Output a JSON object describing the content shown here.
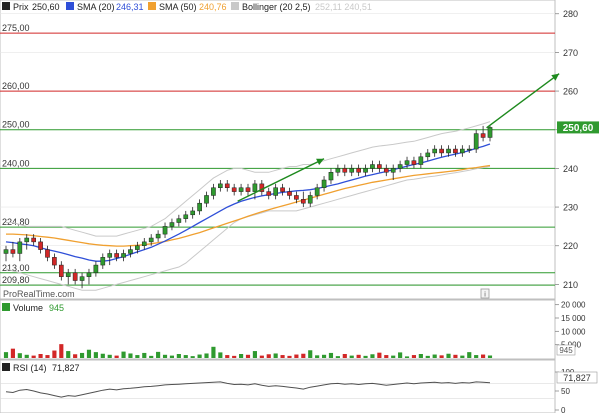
{
  "legend": {
    "price_label": "Prix",
    "price_value": "250,60",
    "sma20_label": "SMA (20)",
    "sma20_value": "246,31",
    "sma50_label": "SMA (50)",
    "sma50_value": "240,76",
    "boll_label": "Bollinger (20 2,5)",
    "boll_value": "252,11  240,51"
  },
  "watermark": "ProRealTime.com",
  "info_icon": "i",
  "price_axis": {
    "ticks": [
      "280",
      "270",
      "260",
      "250",
      "240",
      "230",
      "220",
      "210"
    ],
    "current_label": "250,60"
  },
  "levels": [
    {
      "label": "275,00",
      "value": 275,
      "color": "#d22727"
    },
    {
      "label": "260,00",
      "value": 260,
      "color": "#d22727"
    },
    {
      "label": "250,00",
      "value": 250,
      "color": "#2f9a2f"
    },
    {
      "label": "240,00",
      "value": 240,
      "color": "#2f9a2f"
    },
    {
      "label": "224,80",
      "value": 224.8,
      "color": "#2f9a2f"
    },
    {
      "label": "213,00",
      "value": 213,
      "color": "#2f9a2f"
    },
    {
      "label": "209,80",
      "value": 209.8,
      "color": "#2f9a2f"
    }
  ],
  "volume_panel": {
    "label": "Volume",
    "value": "945",
    "ticks": [
      "20 000",
      "15 000",
      "10 000",
      "5 000"
    ],
    "current_label": "945"
  },
  "rsi_panel": {
    "label": "RSI (14)",
    "value": "71,827",
    "ticks": [
      "100",
      "50",
      "0"
    ],
    "current_label": "71,827"
  },
  "colors": {
    "up": "#2f9a2f",
    "down": "#d22727",
    "sma20": "#2f4fd8",
    "sma50": "#f0a030",
    "bollinger": "#c9c9c9",
    "arrow": "#1e8a1e",
    "rsi": "#505050",
    "grid": "#e6e6e6"
  },
  "chart_data": {
    "type": "candlestick",
    "y_range": [
      207,
      282
    ],
    "candles": [
      [
        218,
        220,
        216,
        219
      ],
      [
        219,
        221,
        217,
        218
      ],
      [
        218,
        222,
        216,
        221
      ],
      [
        221,
        223,
        219,
        222
      ],
      [
        222,
        223,
        220,
        221
      ],
      [
        221,
        222,
        218,
        219
      ],
      [
        219,
        220,
        216,
        217
      ],
      [
        217,
        218,
        214,
        215
      ],
      [
        215,
        216,
        211,
        212
      ],
      [
        212,
        214,
        210,
        213
      ],
      [
        213,
        214,
        210,
        211
      ],
      [
        211,
        213,
        209,
        212
      ],
      [
        212,
        214,
        210,
        213
      ],
      [
        213,
        216,
        212,
        215
      ],
      [
        215,
        218,
        214,
        217
      ],
      [
        217,
        219,
        215,
        218
      ],
      [
        218,
        219,
        216,
        217
      ],
      [
        217,
        219,
        216,
        218
      ],
      [
        218,
        220,
        217,
        219
      ],
      [
        219,
        221,
        218,
        220
      ],
      [
        220,
        222,
        219,
        221
      ],
      [
        221,
        223,
        220,
        222
      ],
      [
        222,
        224,
        221,
        223
      ],
      [
        223,
        226,
        222,
        225
      ],
      [
        225,
        227,
        224,
        226
      ],
      [
        226,
        228,
        225,
        227
      ],
      [
        227,
        229,
        226,
        228
      ],
      [
        228,
        230,
        227,
        229
      ],
      [
        229,
        232,
        228,
        231
      ],
      [
        231,
        234,
        230,
        233
      ],
      [
        233,
        236,
        232,
        235
      ],
      [
        235,
        237,
        234,
        236
      ],
      [
        236,
        237,
        234,
        235
      ],
      [
        235,
        236,
        233,
        234
      ],
      [
        234,
        236,
        233,
        235
      ],
      [
        235,
        236,
        233,
        234
      ],
      [
        234,
        237,
        232,
        236
      ],
      [
        236,
        237,
        233,
        234
      ],
      [
        234,
        235,
        232,
        233
      ],
      [
        233,
        236,
        232,
        235
      ],
      [
        235,
        236,
        233,
        234
      ],
      [
        234,
        235,
        232,
        233
      ],
      [
        233,
        234,
        231,
        232
      ],
      [
        232,
        234,
        230,
        231
      ],
      [
        231,
        234,
        230,
        233
      ],
      [
        233,
        236,
        232,
        235
      ],
      [
        235,
        238,
        234,
        237
      ],
      [
        237,
        240,
        236,
        239
      ],
      [
        239,
        241,
        238,
        240
      ],
      [
        240,
        241,
        238,
        239
      ],
      [
        239,
        241,
        238,
        240
      ],
      [
        240,
        241,
        238,
        239
      ],
      [
        239,
        241,
        238,
        240
      ],
      [
        240,
        242,
        239,
        241
      ],
      [
        241,
        242,
        239,
        240
      ],
      [
        240,
        241,
        238,
        239
      ],
      [
        239,
        241,
        237,
        240
      ],
      [
        240,
        242,
        239,
        241
      ],
      [
        241,
        243,
        240,
        242
      ],
      [
        242,
        243,
        240,
        241
      ],
      [
        241,
        244,
        240,
        243
      ],
      [
        243,
        245,
        242,
        244
      ],
      [
        244,
        246,
        243,
        245
      ],
      [
        245,
        246,
        243,
        244
      ],
      [
        244,
        246,
        243,
        245
      ],
      [
        245,
        246,
        243,
        244
      ],
      [
        244,
        246,
        243,
        245
      ],
      [
        245,
        246,
        244,
        245
      ],
      [
        245,
        250,
        244,
        249
      ],
      [
        249,
        251,
        247,
        248
      ],
      [
        248,
        251,
        247,
        250.6
      ]
    ],
    "sma20": [
      221,
      220.8,
      220.5,
      220.3,
      220,
      219.5,
      219,
      218.6,
      218.2,
      217.7,
      217.2,
      216.8,
      216.3,
      216,
      216,
      216.2,
      216.7,
      217.2,
      217.8,
      218.4,
      219,
      219.6,
      220.4,
      221.2,
      222.1,
      223,
      224,
      225,
      226,
      227,
      228,
      229,
      230,
      230.8,
      231.5,
      232,
      232.5,
      232.9,
      233.2,
      233.5,
      233.8,
      234,
      234.2,
      234.3,
      234.5,
      234.8,
      235.2,
      235.6,
      236,
      236.5,
      237,
      237.5,
      238,
      238.4,
      238.8,
      239.2,
      239.7,
      240.1,
      240.6,
      241,
      241.4,
      241.9,
      242.4,
      242.9,
      243.3,
      243.7,
      244.1,
      244.6,
      245.2,
      245.7,
      246.31
    ],
    "sma50": [
      223,
      223,
      222.9,
      222.8,
      222.6,
      222.4,
      222.2,
      222,
      221.7,
      221.4,
      221.1,
      220.8,
      220.5,
      220.3,
      220.1,
      220,
      219.9,
      219.9,
      220,
      220.1,
      220.3,
      220.5,
      220.8,
      221.1,
      221.5,
      221.9,
      222.4,
      222.9,
      223.4,
      224,
      224.6,
      225.2,
      225.8,
      226.4,
      227,
      227.6,
      228.2,
      228.8,
      229.3,
      229.8,
      230.3,
      230.8,
      231.3,
      231.8,
      232.3,
      232.8,
      233.3,
      233.8,
      234.3,
      234.8,
      235.2,
      235.6,
      236,
      236.4,
      236.7,
      237,
      237.3,
      237.6,
      237.9,
      238.2,
      238.4,
      238.6,
      238.8,
      239,
      239.2,
      239.4,
      239.7,
      240,
      240.2,
      240.5,
      240.76
    ],
    "boll_upper": [
      226,
      226,
      225.5,
      225,
      225,
      225,
      225,
      225,
      225,
      224.5,
      224,
      223.5,
      223,
      222.5,
      222.5,
      222.5,
      222.5,
      223,
      223.5,
      224,
      224.5,
      225,
      226,
      227,
      228.5,
      230,
      231.5,
      233,
      234.5,
      236,
      237.5,
      238.5,
      239.5,
      240,
      240,
      239.5,
      239,
      239,
      239,
      239.5,
      240,
      240.5,
      240.5,
      241,
      241,
      241.5,
      242,
      242.5,
      243,
      243.5,
      244,
      244.5,
      245,
      245.5,
      245.8,
      246,
      246.2,
      246.5,
      246.8,
      247,
      247.5,
      248,
      248.5,
      249,
      249.3,
      249.6,
      250,
      250.5,
      251,
      251.5,
      252.11
    ],
    "boll_lower": [
      214,
      213.5,
      213,
      212.5,
      212,
      211.5,
      211,
      210.5,
      210,
      209.5,
      209,
      208.5,
      208.5,
      208.5,
      209,
      209.5,
      210,
      210.5,
      211,
      211.5,
      212,
      212.5,
      213,
      213.5,
      214,
      214.5,
      215.5,
      217,
      218.5,
      220,
      221.5,
      223,
      224.5,
      226,
      227,
      227.5,
      228,
      228.5,
      229,
      229,
      229,
      229,
      229,
      229.5,
      230,
      230.5,
      231,
      231.5,
      232,
      232.5,
      233,
      233.5,
      234,
      234.5,
      235,
      235.5,
      236,
      236.5,
      237,
      237.2,
      237.5,
      237.8,
      238,
      238.3,
      238.6,
      238.9,
      239.2,
      239.5,
      239.9,
      240.2,
      240.51
    ],
    "volume": [
      2200,
      3500,
      1800,
      1200,
      900,
      1500,
      1100,
      2800,
      5200,
      2600,
      1400,
      1900,
      3100,
      2200,
      1600,
      1200,
      900,
      2400,
      1700,
      1100,
      1900,
      800,
      2300,
      1200,
      900,
      1500,
      1100,
      700,
      1300,
      1700,
      4200,
      2100,
      1100,
      800,
      1500,
      1200,
      2600,
      900,
      1400,
      1700,
      1100,
      800,
      1300,
      1600,
      2900,
      1000,
      1200,
      1900,
      700,
      1500,
      900,
      1200,
      800,
      1400,
      2000,
      1100,
      900,
      2100,
      600,
      1100,
      1500,
      800,
      1300,
      1000,
      1600,
      1200,
      900,
      2200,
      1100,
      1300,
      945
    ],
    "volume_range": [
      0,
      21000
    ],
    "rsi": [
      48,
      46,
      52,
      54,
      50,
      45,
      42,
      38,
      34,
      38,
      36,
      40,
      44,
      48,
      52,
      55,
      53,
      56,
      57,
      59,
      61,
      62,
      64,
      66,
      67,
      68,
      69,
      70,
      71,
      72,
      73,
      74,
      70,
      67,
      68,
      66,
      69,
      65,
      62,
      64,
      62,
      60,
      58,
      55,
      60,
      63,
      66,
      69,
      70,
      68,
      69,
      67,
      69,
      70,
      68,
      65,
      67,
      69,
      71,
      69,
      71,
      72,
      73,
      71,
      72,
      70,
      72,
      71,
      74,
      73,
      71.827
    ],
    "rsi_range": [
      0,
      100
    ],
    "trend_arrows": [
      {
        "from": [
          33.5,
          231.5
        ],
        "to": [
          46,
          242.5
        ]
      },
      {
        "from": [
          69.5,
          250.5
        ],
        "to": [
          80,
          264.5
        ]
      }
    ]
  }
}
